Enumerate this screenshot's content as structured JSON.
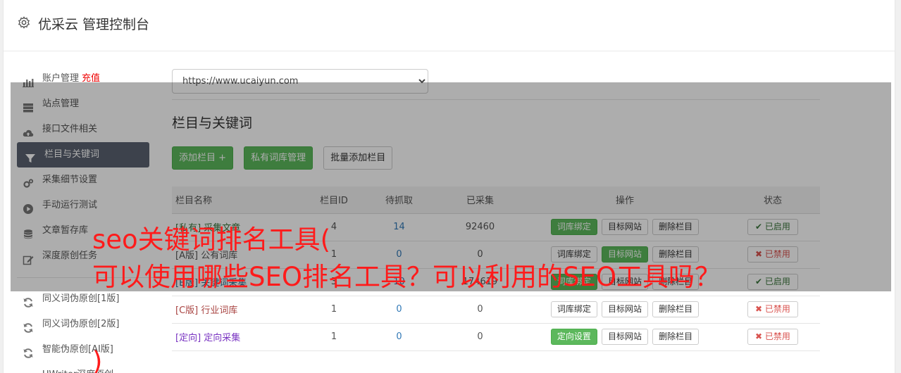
{
  "header": {
    "title": "优采云 管理控制台",
    "icon": "gear-icon"
  },
  "sidebar": {
    "items": [
      {
        "label": "账户管理",
        "extra": "充值",
        "icon": "bar-chart-icon"
      },
      {
        "label": "站点管理",
        "icon": "server-icon"
      },
      {
        "label": "接口文件相关",
        "icon": "cloud-upload-icon"
      },
      {
        "label": "栏目与关键词",
        "icon": "filter-icon",
        "active": true
      },
      {
        "label": "采集细节设置",
        "icon": "cogs-icon"
      },
      {
        "label": "手动运行测试",
        "icon": "play-circle-icon"
      },
      {
        "label": "文章暂存库",
        "icon": "database-icon"
      },
      {
        "label": "深度原创任务",
        "icon": "edit-icon"
      }
    ],
    "items2": [
      {
        "label": "同义词伪原创[1版]",
        "icon": "refresh-icon"
      },
      {
        "label": "同义词伪原创[2版]",
        "icon": "refresh-icon"
      },
      {
        "label": "智能伪原创[AI版]",
        "icon": "refresh-icon"
      },
      {
        "label": "UWriter深度原创",
        "icon": "edit-icon"
      }
    ]
  },
  "main": {
    "site_select": "https://www.ucaiyun.com",
    "section_title": "栏目与关键词",
    "buttons": {
      "add": "添加栏目 +",
      "private_lib": "私有词库管理",
      "batch_add": "批量添加栏目"
    },
    "table": {
      "headers": [
        "栏目名称",
        "栏目ID",
        "待抓取",
        "已采集",
        "操作",
        "状态"
      ],
      "rows": [
        {
          "tag": "[私有]",
          "name": "采集文章",
          "tag_color": "green",
          "id": "4",
          "pending": "14",
          "collected": "92460",
          "op1": "词库绑定",
          "op2": "目标网站",
          "op3": "删除栏目",
          "op1_green": true,
          "op2_green": false,
          "status": "已启用",
          "status_on": true
        },
        {
          "tag": "[A版]",
          "name": "公有词库",
          "tag_color": "plain",
          "id": "1",
          "pending": "0",
          "collected": "0",
          "op1": "词库绑定",
          "op2": "目标网站",
          "op3": "删除栏目",
          "op1_green": false,
          "op2_green": true,
          "status": "已禁用",
          "status_on": false
        },
        {
          "tag": "[B版]",
          "name": "关键词采集",
          "tag_color": "blue",
          "id": "3",
          "pending": "10",
          "collected": "174619",
          "op1": "词库绑定",
          "op2": "目标网站",
          "op3": "删除栏目",
          "op1_green": true,
          "op2_green": false,
          "status": "已启用",
          "status_on": true
        },
        {
          "tag": "[C版]",
          "name": "行业词库",
          "tag_color": "red",
          "id": "1",
          "pending": "0",
          "collected": "0",
          "op1": "词库绑定",
          "op2": "目标网站",
          "op3": "删除栏目",
          "op1_green": false,
          "op2_green": false,
          "status": "已禁用",
          "status_on": false
        },
        {
          "tag": "[定向]",
          "name": "定向采集",
          "tag_color": "purple",
          "id": "1",
          "pending": "0",
          "collected": "0",
          "op1": "定向设置",
          "op2": "目标网站",
          "op3": "删除栏目",
          "op1_green": true,
          "op2_green": false,
          "status": "已禁用",
          "status_on": false
        }
      ]
    }
  },
  "overlay": {
    "line1": "seo关键词排名工具(",
    "line2": "可以使用哪些SEO排名工具？可以利用的SEO工具吗？",
    "line3": ")"
  },
  "colors": {
    "accent_green": "#5cb85c",
    "active_nav": "#5a6270",
    "overlay_text": "#ff1b1b",
    "recharge": "#e00000"
  }
}
